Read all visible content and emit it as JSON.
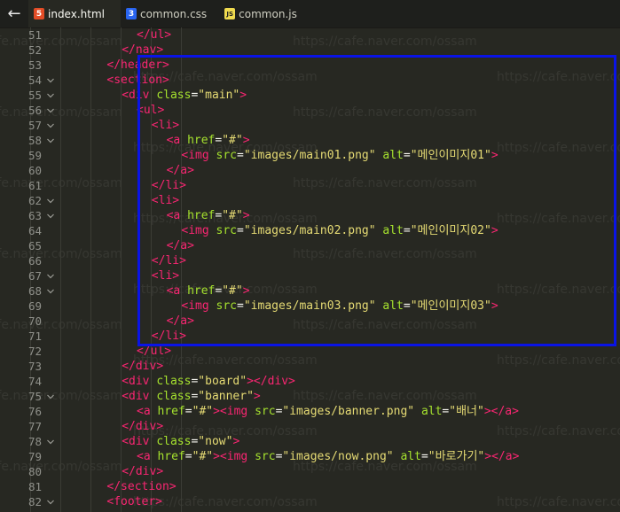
{
  "tabs": [
    {
      "label": "index.html",
      "icon": "html5-icon",
      "icon_glyph": "5",
      "color": "#e34c26",
      "active": true
    },
    {
      "label": "common.css",
      "icon": "css3-icon",
      "icon_glyph": "3",
      "color": "#2965f1",
      "active": false
    },
    {
      "label": "common.js",
      "icon": "js-icon",
      "icon_glyph": "JS",
      "color": "#f0db4f",
      "active": false
    }
  ],
  "back_glyph": "←",
  "watermark": "https://cafe.naver.com/ossam",
  "colors": {
    "tag": "#f92672",
    "attr": "#a6e22e",
    "string": "#e6db74",
    "text": "#f8f8f2",
    "highlight_box": "#0a14e6"
  },
  "lines": [
    {
      "n": "51",
      "fold": false,
      "indent": 10,
      "tokens": [
        [
          "tg",
          "</ul>"
        ]
      ]
    },
    {
      "n": "52",
      "fold": false,
      "indent": 8,
      "tokens": [
        [
          "tg",
          "</nav>"
        ]
      ]
    },
    {
      "n": "53",
      "fold": false,
      "indent": 6,
      "tokens": [
        [
          "tg",
          "</header>"
        ]
      ]
    },
    {
      "n": "54",
      "fold": true,
      "indent": 6,
      "tokens": [
        [
          "tg",
          "<section>"
        ]
      ]
    },
    {
      "n": "55",
      "fold": true,
      "indent": 8,
      "tokens": [
        [
          "tg",
          "<div "
        ],
        [
          "at",
          "class"
        ],
        [
          "tx",
          "="
        ],
        [
          "st",
          "\"main\""
        ],
        [
          "tg",
          ">"
        ]
      ]
    },
    {
      "n": "56",
      "fold": true,
      "indent": 10,
      "tokens": [
        [
          "tg",
          "<ul>"
        ]
      ]
    },
    {
      "n": "57",
      "fold": true,
      "indent": 12,
      "tokens": [
        [
          "tg",
          "<li>"
        ]
      ]
    },
    {
      "n": "58",
      "fold": true,
      "indent": 14,
      "tokens": [
        [
          "tg",
          "<a "
        ],
        [
          "at",
          "href"
        ],
        [
          "tx",
          "="
        ],
        [
          "st",
          "\"#\""
        ],
        [
          "tg",
          ">"
        ]
      ]
    },
    {
      "n": "59",
      "fold": false,
      "indent": 16,
      "tokens": [
        [
          "tg",
          "<img "
        ],
        [
          "at",
          "src"
        ],
        [
          "tx",
          "="
        ],
        [
          "st",
          "\"images/main01.png\""
        ],
        [
          "tx",
          " "
        ],
        [
          "at",
          "alt"
        ],
        [
          "tx",
          "="
        ],
        [
          "st",
          "\"메인이미지01\""
        ],
        [
          "tg",
          ">"
        ]
      ]
    },
    {
      "n": "60",
      "fold": false,
      "indent": 14,
      "tokens": [
        [
          "tg",
          "</a>"
        ]
      ]
    },
    {
      "n": "61",
      "fold": false,
      "indent": 12,
      "tokens": [
        [
          "tg",
          "</li>"
        ]
      ]
    },
    {
      "n": "62",
      "fold": true,
      "indent": 12,
      "tokens": [
        [
          "tg",
          "<li>"
        ]
      ]
    },
    {
      "n": "63",
      "fold": true,
      "indent": 14,
      "tokens": [
        [
          "tg",
          "<a "
        ],
        [
          "at",
          "href"
        ],
        [
          "tx",
          "="
        ],
        [
          "st",
          "\"#\""
        ],
        [
          "tg",
          ">"
        ]
      ]
    },
    {
      "n": "64",
      "fold": false,
      "indent": 16,
      "tokens": [
        [
          "tg",
          "<img "
        ],
        [
          "at",
          "src"
        ],
        [
          "tx",
          "="
        ],
        [
          "st",
          "\"images/main02.png\""
        ],
        [
          "tx",
          " "
        ],
        [
          "at",
          "alt"
        ],
        [
          "tx",
          "="
        ],
        [
          "st",
          "\"메인이미지02\""
        ],
        [
          "tg",
          ">"
        ]
      ]
    },
    {
      "n": "65",
      "fold": false,
      "indent": 14,
      "tokens": [
        [
          "tg",
          "</a>"
        ]
      ]
    },
    {
      "n": "66",
      "fold": false,
      "indent": 12,
      "tokens": [
        [
          "tg",
          "</li>"
        ]
      ]
    },
    {
      "n": "67",
      "fold": true,
      "indent": 12,
      "tokens": [
        [
          "tg",
          "<li>"
        ]
      ]
    },
    {
      "n": "68",
      "fold": true,
      "indent": 14,
      "tokens": [
        [
          "tg",
          "<a "
        ],
        [
          "at",
          "href"
        ],
        [
          "tx",
          "="
        ],
        [
          "st",
          "\"#\""
        ],
        [
          "tg",
          ">"
        ]
      ]
    },
    {
      "n": "69",
      "fold": false,
      "indent": 16,
      "tokens": [
        [
          "tg",
          "<img "
        ],
        [
          "at",
          "src"
        ],
        [
          "tx",
          "="
        ],
        [
          "st",
          "\"images/main03.png\""
        ],
        [
          "tx",
          " "
        ],
        [
          "at",
          "alt"
        ],
        [
          "tx",
          "="
        ],
        [
          "st",
          "\"메인이미지03\""
        ],
        [
          "tg",
          ">"
        ]
      ]
    },
    {
      "n": "70",
      "fold": false,
      "indent": 14,
      "tokens": [
        [
          "tg",
          "</a>"
        ]
      ]
    },
    {
      "n": "71",
      "fold": false,
      "indent": 12,
      "tokens": [
        [
          "tg",
          "</li>"
        ]
      ]
    },
    {
      "n": "72",
      "fold": false,
      "indent": 10,
      "tokens": [
        [
          "tg",
          "</ul>"
        ]
      ]
    },
    {
      "n": "73",
      "fold": false,
      "indent": 8,
      "tokens": [
        [
          "tg",
          "</div>"
        ]
      ]
    },
    {
      "n": "74",
      "fold": false,
      "indent": 8,
      "tokens": [
        [
          "tg",
          "<div "
        ],
        [
          "at",
          "class"
        ],
        [
          "tx",
          "="
        ],
        [
          "st",
          "\"board\""
        ],
        [
          "tg",
          "></div>"
        ]
      ]
    },
    {
      "n": "75",
      "fold": true,
      "indent": 8,
      "tokens": [
        [
          "tg",
          "<div "
        ],
        [
          "at",
          "class"
        ],
        [
          "tx",
          "="
        ],
        [
          "st",
          "\"banner\""
        ],
        [
          "tg",
          ">"
        ]
      ]
    },
    {
      "n": "76",
      "fold": false,
      "indent": 10,
      "tokens": [
        [
          "tg",
          "<a "
        ],
        [
          "at",
          "href"
        ],
        [
          "tx",
          "="
        ],
        [
          "st",
          "\"#\""
        ],
        [
          "tg",
          "><img "
        ],
        [
          "at",
          "src"
        ],
        [
          "tx",
          "="
        ],
        [
          "st",
          "\"images/banner.png\""
        ],
        [
          "tx",
          " "
        ],
        [
          "at",
          "alt"
        ],
        [
          "tx",
          "="
        ],
        [
          "st",
          "\"배너\""
        ],
        [
          "tg",
          "></a>"
        ]
      ]
    },
    {
      "n": "77",
      "fold": false,
      "indent": 8,
      "tokens": [
        [
          "tg",
          "</div>"
        ]
      ]
    },
    {
      "n": "78",
      "fold": true,
      "indent": 8,
      "tokens": [
        [
          "tg",
          "<div "
        ],
        [
          "at",
          "class"
        ],
        [
          "tx",
          "="
        ],
        [
          "st",
          "\"now\""
        ],
        [
          "tg",
          ">"
        ]
      ]
    },
    {
      "n": "79",
      "fold": false,
      "indent": 10,
      "tokens": [
        [
          "tg",
          "<a "
        ],
        [
          "at",
          "href"
        ],
        [
          "tx",
          "="
        ],
        [
          "st",
          "\"#\""
        ],
        [
          "tg",
          "><img "
        ],
        [
          "at",
          "src"
        ],
        [
          "tx",
          "="
        ],
        [
          "st",
          "\"images/now.png\""
        ],
        [
          "tx",
          " "
        ],
        [
          "at",
          "alt"
        ],
        [
          "tx",
          "="
        ],
        [
          "st",
          "\"바로가기\""
        ],
        [
          "tg",
          "></a>"
        ]
      ]
    },
    {
      "n": "80",
      "fold": false,
      "indent": 8,
      "tokens": [
        [
          "tg",
          "</div>"
        ]
      ]
    },
    {
      "n": "81",
      "fold": false,
      "indent": 6,
      "tokens": [
        [
          "tg",
          "</section>"
        ]
      ]
    },
    {
      "n": "82",
      "fold": true,
      "indent": 6,
      "tokens": [
        [
          "tg",
          "<footer>"
        ]
      ]
    }
  ]
}
